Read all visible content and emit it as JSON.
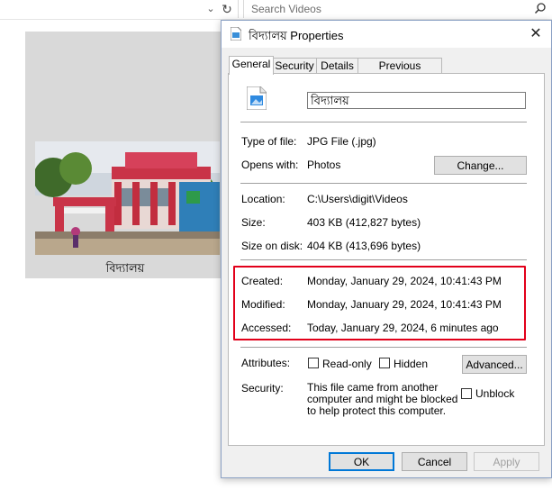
{
  "explorer": {
    "search_placeholder": "Search Videos",
    "thumbnail_label": "বিদ্যালয়"
  },
  "dialog": {
    "title": "বিদ্যালয় Properties",
    "tabs": [
      "General",
      "Security",
      "Details",
      "Previous Versions"
    ],
    "active_tab": "General",
    "file_name": "বিদ্যালয়",
    "rows": {
      "type_label": "Type of file:",
      "type_value": "JPG File (.jpg)",
      "opens_label": "Opens with:",
      "opens_value": "Photos",
      "change_button": "Change...",
      "location_label": "Location:",
      "location_value": "C:\\Users\\digit\\Videos",
      "size_label": "Size:",
      "size_value": "403 KB (412,827 bytes)",
      "size_disk_label": "Size on disk:",
      "size_disk_value": "404 KB (413,696 bytes)",
      "created_label": "Created:",
      "created_value": "Monday, January 29, 2024, 10:41:43 PM",
      "modified_label": "Modified:",
      "modified_value": "Monday, January 29, 2024, 10:41:43 PM",
      "accessed_label": "Accessed:",
      "accessed_value": "Today, January 29, 2024, 6 minutes ago",
      "attributes_label": "Attributes:",
      "readonly_label": "Read-only",
      "hidden_label": "Hidden",
      "advanced_button": "Advanced...",
      "security_label": "Security:",
      "security_text": "This file came from another computer and might be blocked to help protect this computer.",
      "unblock_label": "Unblock"
    },
    "buttons": {
      "ok": "OK",
      "cancel": "Cancel",
      "apply": "Apply"
    }
  },
  "colors": {
    "highlight_box": "#e2001a",
    "default_button_border": "#0078d7"
  },
  "icons": [
    "chevron-down-icon",
    "refresh-icon",
    "search-icon",
    "jpg-file-icon",
    "close-icon"
  ]
}
